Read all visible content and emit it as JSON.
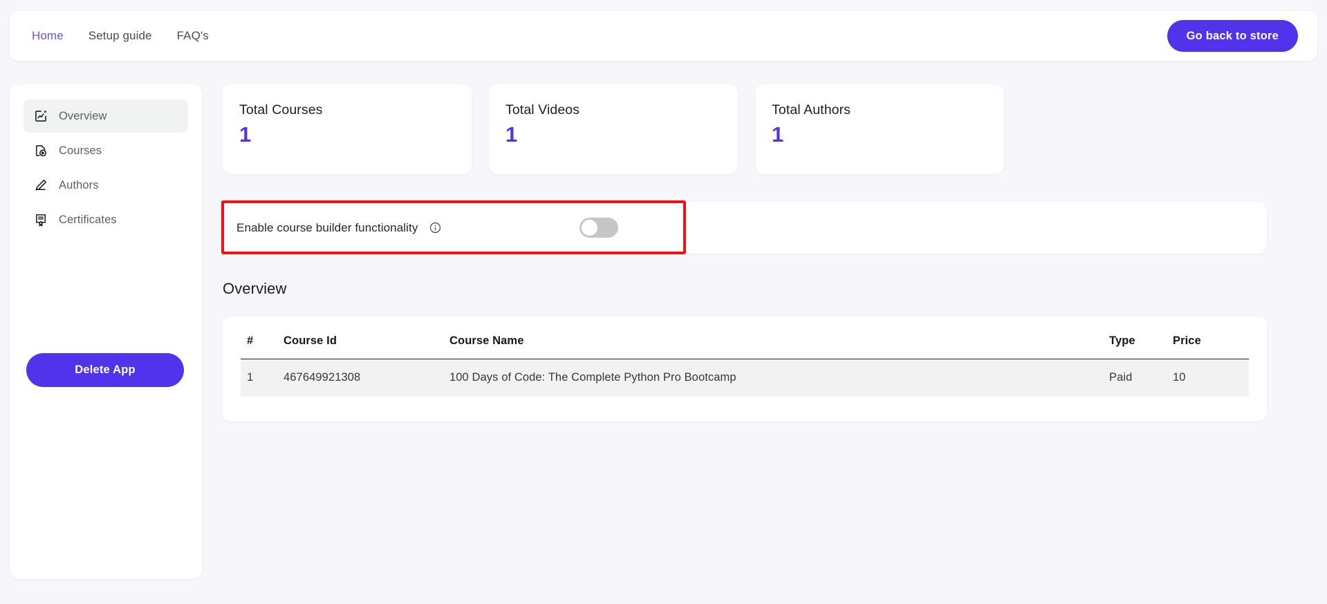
{
  "header": {
    "nav": [
      {
        "label": "Home",
        "active": true
      },
      {
        "label": "Setup guide",
        "active": false
      },
      {
        "label": "FAQ's",
        "active": false
      }
    ],
    "store_button": "Go back to store"
  },
  "sidebar": {
    "items": [
      {
        "label": "Overview",
        "icon": "chart-box-icon",
        "active": true
      },
      {
        "label": "Courses",
        "icon": "course-play-icon",
        "active": false
      },
      {
        "label": "Authors",
        "icon": "pencil-icon",
        "active": false
      },
      {
        "label": "Certificates",
        "icon": "certificate-icon",
        "active": false
      }
    ],
    "delete_button": "Delete App"
  },
  "stats": [
    {
      "title": "Total Courses",
      "value": "1"
    },
    {
      "title": "Total Videos",
      "value": "1"
    },
    {
      "title": "Total Authors",
      "value": "1"
    }
  ],
  "course_builder": {
    "label": "Enable course builder functionality",
    "info_icon": "info-circle-icon",
    "enabled": false,
    "highlight_color": "#f50f10"
  },
  "overview": {
    "title": "Overview",
    "columns": [
      "#",
      "Course Id",
      "Course Name",
      "Type",
      "Price"
    ],
    "rows": [
      {
        "num": "1",
        "course_id": "467649921308",
        "course_name": "100 Days of Code: The Complete Python Pro Bootcamp",
        "type": "Paid",
        "price": "10"
      }
    ]
  },
  "colors": {
    "accent": "#5233ec",
    "accent_link": "#6a52ef",
    "page_background": "#f6f6fb",
    "card_background": "#ffffff",
    "toggle_off": "#c6c6c9",
    "row_background": "#f2f2f2"
  }
}
